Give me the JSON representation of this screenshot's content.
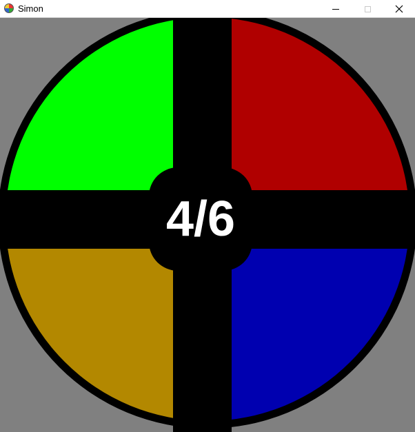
{
  "window": {
    "title": "Simon",
    "controls": {
      "minimize": "minimize",
      "maximize": "maximize",
      "close": "close"
    }
  },
  "game": {
    "progress_text": "4/6",
    "pads": [
      {
        "id": "green",
        "color": "#00ff00"
      },
      {
        "id": "red",
        "color": "#b00000"
      },
      {
        "id": "yellow",
        "color": "#b38800"
      },
      {
        "id": "blue",
        "color": "#0000b0"
      }
    ],
    "board_color": "#000000",
    "background_color": "#808080"
  }
}
